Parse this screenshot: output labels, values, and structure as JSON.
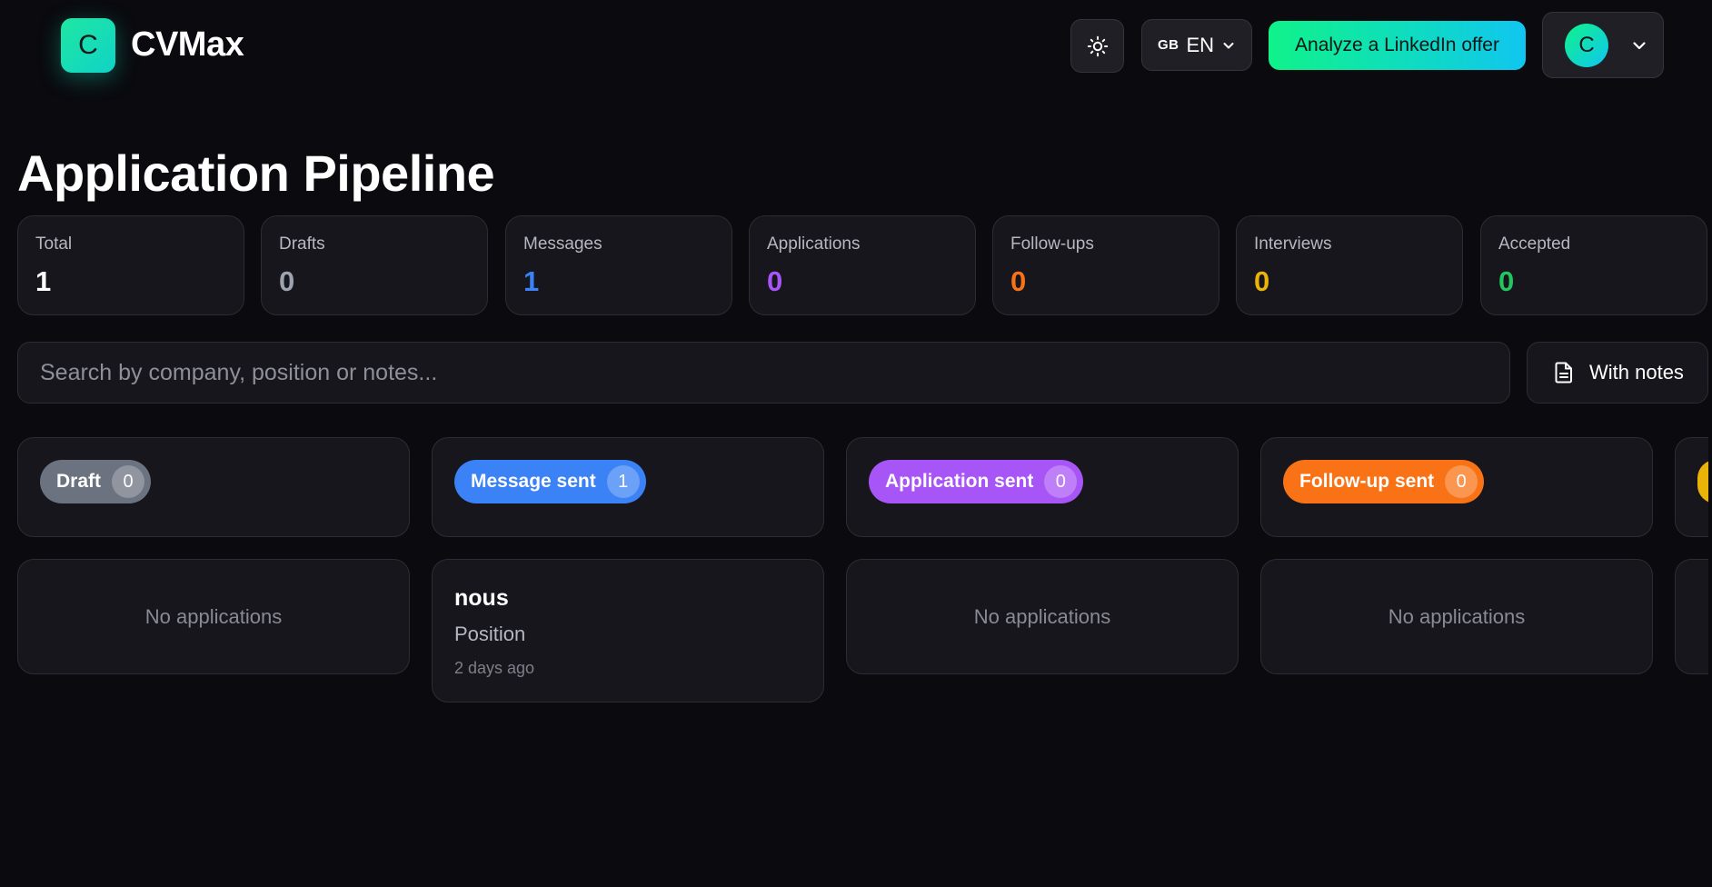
{
  "app": {
    "logo_letter": "C",
    "name": "CVMax"
  },
  "header": {
    "theme_icon": "sun-icon",
    "language": {
      "flag": "GB",
      "code": "EN",
      "icon": "chevron-down-icon"
    },
    "analyze_label": "Analyze a LinkedIn offer",
    "user": {
      "initial": "C",
      "icon": "chevron-down-icon"
    }
  },
  "page": {
    "title": "Application Pipeline"
  },
  "stats": [
    {
      "label": "Total",
      "value": "1",
      "color": "#ffffff"
    },
    {
      "label": "Drafts",
      "value": "0",
      "color": "#9ca3af"
    },
    {
      "label": "Messages",
      "value": "1",
      "color": "#3b82f6"
    },
    {
      "label": "Applications",
      "value": "0",
      "color": "#a855f7"
    },
    {
      "label": "Follow-ups",
      "value": "0",
      "color": "#f97316"
    },
    {
      "label": "Interviews",
      "value": "0",
      "color": "#eab308"
    },
    {
      "label": "Accepted",
      "value": "0",
      "color": "#22c55e"
    }
  ],
  "search": {
    "placeholder": "Search by company, position or notes...",
    "value": ""
  },
  "notes_filter": {
    "label": "With notes",
    "icon": "document-icon"
  },
  "columns": [
    {
      "label": "Draft",
      "count": "0",
      "color": "#6b7280",
      "empty_text": "No applications"
    },
    {
      "label": "Message sent",
      "count": "1",
      "color": "#3b82f6",
      "cards": [
        {
          "company": "nous",
          "position": "Position",
          "time": "2 days ago"
        }
      ]
    },
    {
      "label": "Application sent",
      "count": "0",
      "color": "#a855f7",
      "empty_text": "No applications"
    },
    {
      "label": "Follow-up sent",
      "count": "0",
      "color": "#f97316",
      "empty_text": "No applications"
    }
  ],
  "partial_column_color": "#eab308"
}
